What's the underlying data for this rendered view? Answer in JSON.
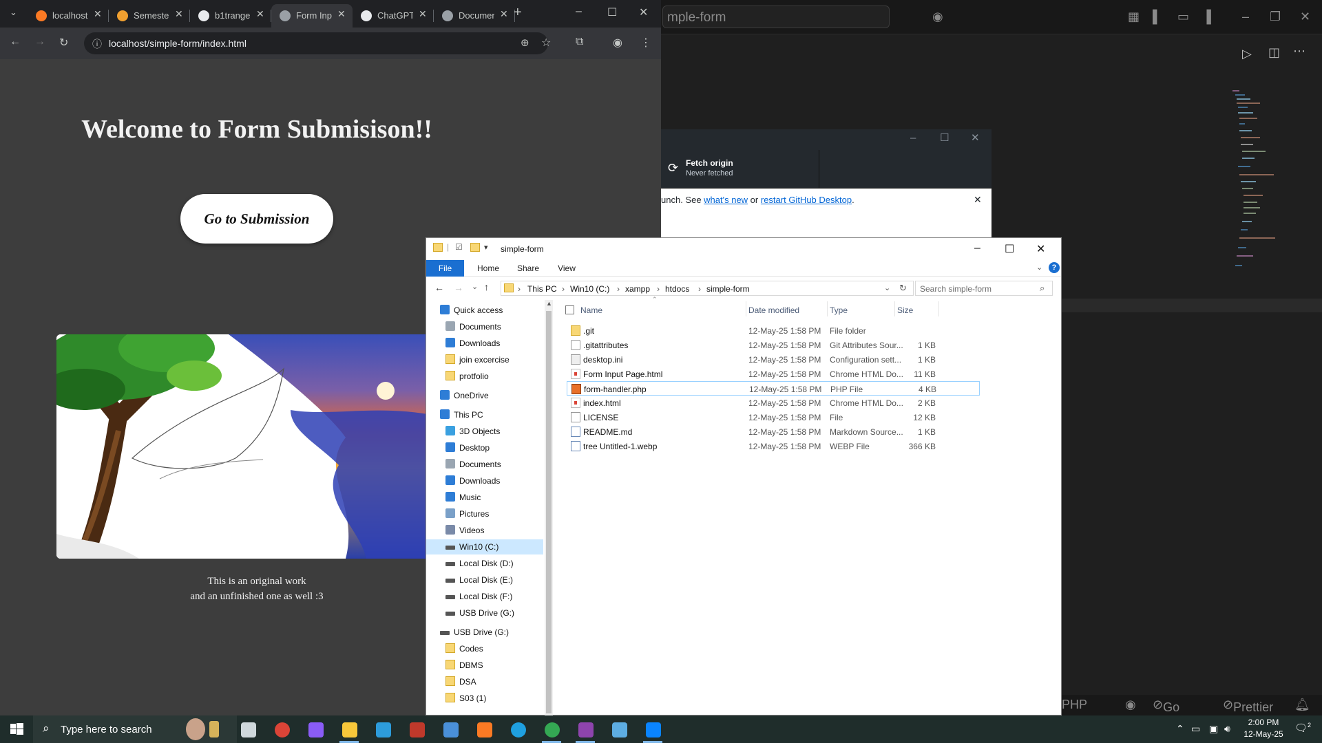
{
  "vscode": {
    "command_center_text": "mple-form",
    "status_items": [
      "PHP",
      "Go Live",
      "Prettier"
    ]
  },
  "github_desktop": {
    "fetch_title": "Fetch origin",
    "fetch_subtitle": "Never fetched",
    "banner_prefix": "unch. See ",
    "banner_link1": "what's new",
    "banner_mid": " or ",
    "banner_link2": "restart GitHub Desktop",
    "banner_suffix": "."
  },
  "chrome": {
    "tabs": [
      {
        "label": "localhost",
        "icon": "xampp-icon",
        "color": "#fb7a24"
      },
      {
        "label": "Semester",
        "icon": "moodle-icon",
        "color": "#f0a030"
      },
      {
        "label": "b1trange",
        "icon": "github-icon",
        "color": "#e8eaed"
      },
      {
        "label": "Form Input",
        "icon": "globe-icon",
        "color": "#9aa0a6",
        "active": true
      },
      {
        "label": "ChatGPT",
        "icon": "openai-icon",
        "color": "#e8eaed"
      },
      {
        "label": "Document",
        "icon": "globe-icon",
        "color": "#9aa0a6"
      }
    ],
    "url": "localhost/simple-form/index.html",
    "page": {
      "heading": "Welcome to Form Submisison!!",
      "button_label": "Go to Submission",
      "caption_line1": "This is an original work",
      "caption_line2": "and an unfinished one as well :3"
    }
  },
  "explorer": {
    "title": "simple-form",
    "ribbon_tabs": [
      "File",
      "Home",
      "Share",
      "View"
    ],
    "breadcrumb": [
      "This PC",
      "Win10 (C:)",
      "xampp",
      "htdocs",
      "simple-form"
    ],
    "search_placeholder": "Search simple-form",
    "columns": [
      "Name",
      "Date modified",
      "Type",
      "Size"
    ],
    "files": [
      {
        "name": ".git",
        "date": "12-May-25 1:58 PM",
        "type": "File folder",
        "size": "",
        "icon": "folder-icon"
      },
      {
        "name": ".gitattributes",
        "date": "12-May-25 1:58 PM",
        "type": "Git Attributes Sour...",
        "size": "1 KB",
        "icon": "gear-file-icon"
      },
      {
        "name": "desktop.ini",
        "date": "12-May-25 1:58 PM",
        "type": "Configuration sett...",
        "size": "1 KB",
        "icon": "settings-file-icon"
      },
      {
        "name": "Form Input Page.html",
        "date": "12-May-25 1:58 PM",
        "type": "Chrome HTML Do...",
        "size": "11 KB",
        "icon": "chrome-file-icon"
      },
      {
        "name": "form-handler.php",
        "date": "12-May-25 1:58 PM",
        "type": "PHP File",
        "size": "4 KB",
        "icon": "php-file-icon"
      },
      {
        "name": "index.html",
        "date": "12-May-25 1:58 PM",
        "type": "Chrome HTML Do...",
        "size": "2 KB",
        "icon": "chrome-file-icon"
      },
      {
        "name": "LICENSE",
        "date": "12-May-25 1:58 PM",
        "type": "File",
        "size": "12 KB",
        "icon": "blank-file-icon"
      },
      {
        "name": "README.md",
        "date": "12-May-25 1:58 PM",
        "type": "Markdown Source...",
        "size": "1 KB",
        "icon": "markdown-file-icon"
      },
      {
        "name": "tree Untitled-1.webp",
        "date": "12-May-25 1:58 PM",
        "type": "WEBP File",
        "size": "366 KB",
        "icon": "image-file-icon"
      }
    ],
    "nav": [
      {
        "label": "Quick access",
        "icon": "star-icon",
        "level": 0
      },
      {
        "label": "Documents",
        "icon": "documents-icon",
        "level": 1
      },
      {
        "label": "Downloads",
        "icon": "download-icon",
        "level": 1
      },
      {
        "label": "join excercise",
        "icon": "folder-icon",
        "level": 1
      },
      {
        "label": "protfolio",
        "icon": "folder-icon",
        "level": 1
      },
      {
        "label": "OneDrive",
        "icon": "cloud-icon",
        "level": 0
      },
      {
        "label": "This PC",
        "icon": "computer-icon",
        "level": 0
      },
      {
        "label": "3D Objects",
        "icon": "cube-icon",
        "level": 1
      },
      {
        "label": "Desktop",
        "icon": "desktop-icon",
        "level": 1
      },
      {
        "label": "Documents",
        "icon": "documents-icon",
        "level": 1
      },
      {
        "label": "Downloads",
        "icon": "download-icon",
        "level": 1
      },
      {
        "label": "Music",
        "icon": "music-icon",
        "level": 1
      },
      {
        "label": "Pictures",
        "icon": "pictures-icon",
        "level": 1
      },
      {
        "label": "Videos",
        "icon": "videos-icon",
        "level": 1
      },
      {
        "label": "Win10 (C:)",
        "icon": "drive-icon",
        "level": 1,
        "selected": true
      },
      {
        "label": "Local Disk (D:)",
        "icon": "drive-icon",
        "level": 1
      },
      {
        "label": "Local Disk (E:)",
        "icon": "drive-icon",
        "level": 1
      },
      {
        "label": "Local Disk (F:)",
        "icon": "drive-icon",
        "level": 1
      },
      {
        "label": "USB Drive (G:)",
        "icon": "drive-icon",
        "level": 1
      },
      {
        "label": "USB Drive (G:)",
        "icon": "drive-icon",
        "level": 0
      },
      {
        "label": "Codes",
        "icon": "folder-icon",
        "level": 1
      },
      {
        "label": "DBMS",
        "icon": "folder-icon",
        "level": 1
      },
      {
        "label": "DSA",
        "icon": "folder-icon",
        "level": 1
      },
      {
        "label": "S03 (1)",
        "icon": "folder-icon",
        "level": 1
      }
    ]
  },
  "taskbar": {
    "search_placeholder": "Type here to search",
    "time": "2:00 PM",
    "date": "12-May-25",
    "notifications": "2",
    "apps": [
      {
        "name": "task-view",
        "color": "#cfd8dc"
      },
      {
        "name": "chrome",
        "color": "#db4437"
      },
      {
        "name": "copilot",
        "color": "#8a5cf6"
      },
      {
        "name": "file-explorer",
        "color": "#f8c73a",
        "running": true
      },
      {
        "name": "search-app",
        "color": "#2d9cdb"
      },
      {
        "name": "photos",
        "color": "#c0392b"
      },
      {
        "name": "3d-app",
        "color": "#4a90d9"
      },
      {
        "name": "xampp",
        "color": "#fb7a24"
      },
      {
        "name": "edge",
        "color": "#1fa0e0"
      },
      {
        "name": "chrome-running",
        "color": "#34a853",
        "running": true
      },
      {
        "name": "github-desktop",
        "color": "#8e44ad",
        "running": true
      },
      {
        "name": "notes",
        "color": "#5dade2"
      },
      {
        "name": "vscode",
        "color": "#0a84ff",
        "running": true
      }
    ]
  }
}
